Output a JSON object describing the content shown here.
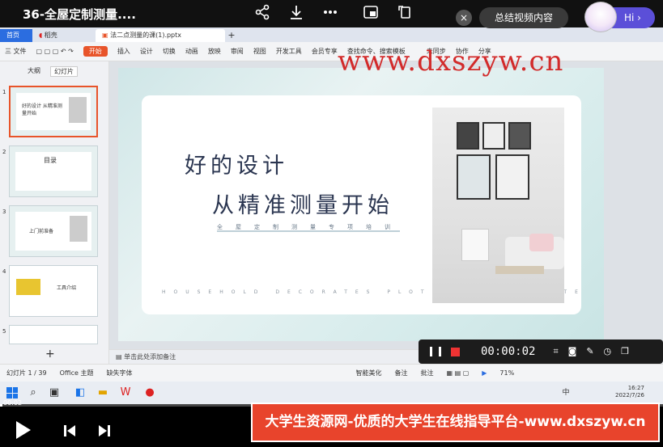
{
  "video": {
    "title": "36-全屋定制测量....",
    "close_label": "×",
    "summary_label": "总结视频内容",
    "hi_label": "Hi",
    "current_time": "00:02",
    "progress": 0.004
  },
  "tabs": {
    "home": "首页",
    "docer": "稻壳",
    "file": "法二点测量的课(1).pptx",
    "plus": "+"
  },
  "ribbon": {
    "items": [
      "三 文件",
      "开始",
      "插入",
      "设计",
      "切换",
      "动画",
      "放映",
      "审阅",
      "视图",
      "开发工具",
      "会员专享",
      "查找命令、搜索模板",
      "未同步",
      "协作",
      "分享"
    ],
    "start_label": "开始"
  },
  "watermark": "www.dxszyw.cn",
  "left_panel": {
    "tabs": [
      "大纲",
      "幻灯片"
    ],
    "slides": [
      {
        "num": "1",
        "text": "好的设计 从精准测量开始"
      },
      {
        "num": "2",
        "text": "目录"
      },
      {
        "num": "3",
        "text": "上门前准备"
      },
      {
        "num": "4",
        "text": "工具介绍"
      },
      {
        "num": "5",
        "text": ""
      }
    ],
    "add": "+"
  },
  "slide": {
    "line1": "好的设计",
    "line2": "从精准测量开始",
    "subline": "全屋定制测量专项培训",
    "english": "HOUSEHOLD DECORATES PLOT PLAN TEMPLATE"
  },
  "notes": "单击此处添加备注",
  "status": {
    "slide_count": "幻灯片 1 / 39",
    "theme": "Office 主题",
    "font_missing": "缺失字体",
    "beautify": "智能美化",
    "remarks": "备注",
    "comments": "批注",
    "zoom": "71%"
  },
  "recorder": {
    "time": "00:00:02"
  },
  "taskbar": {
    "input_lang": "中",
    "clock_time": "16:27",
    "clock_date": "2022/7/26"
  },
  "banner": "大学生资源网-优质的大学生在线指导平台-www.dxszyw.cn",
  "colors": {
    "accent": "#e8542a",
    "banner": "#e8442c",
    "watermark": "#d22a2a",
    "slide_text": "#2a3550"
  }
}
